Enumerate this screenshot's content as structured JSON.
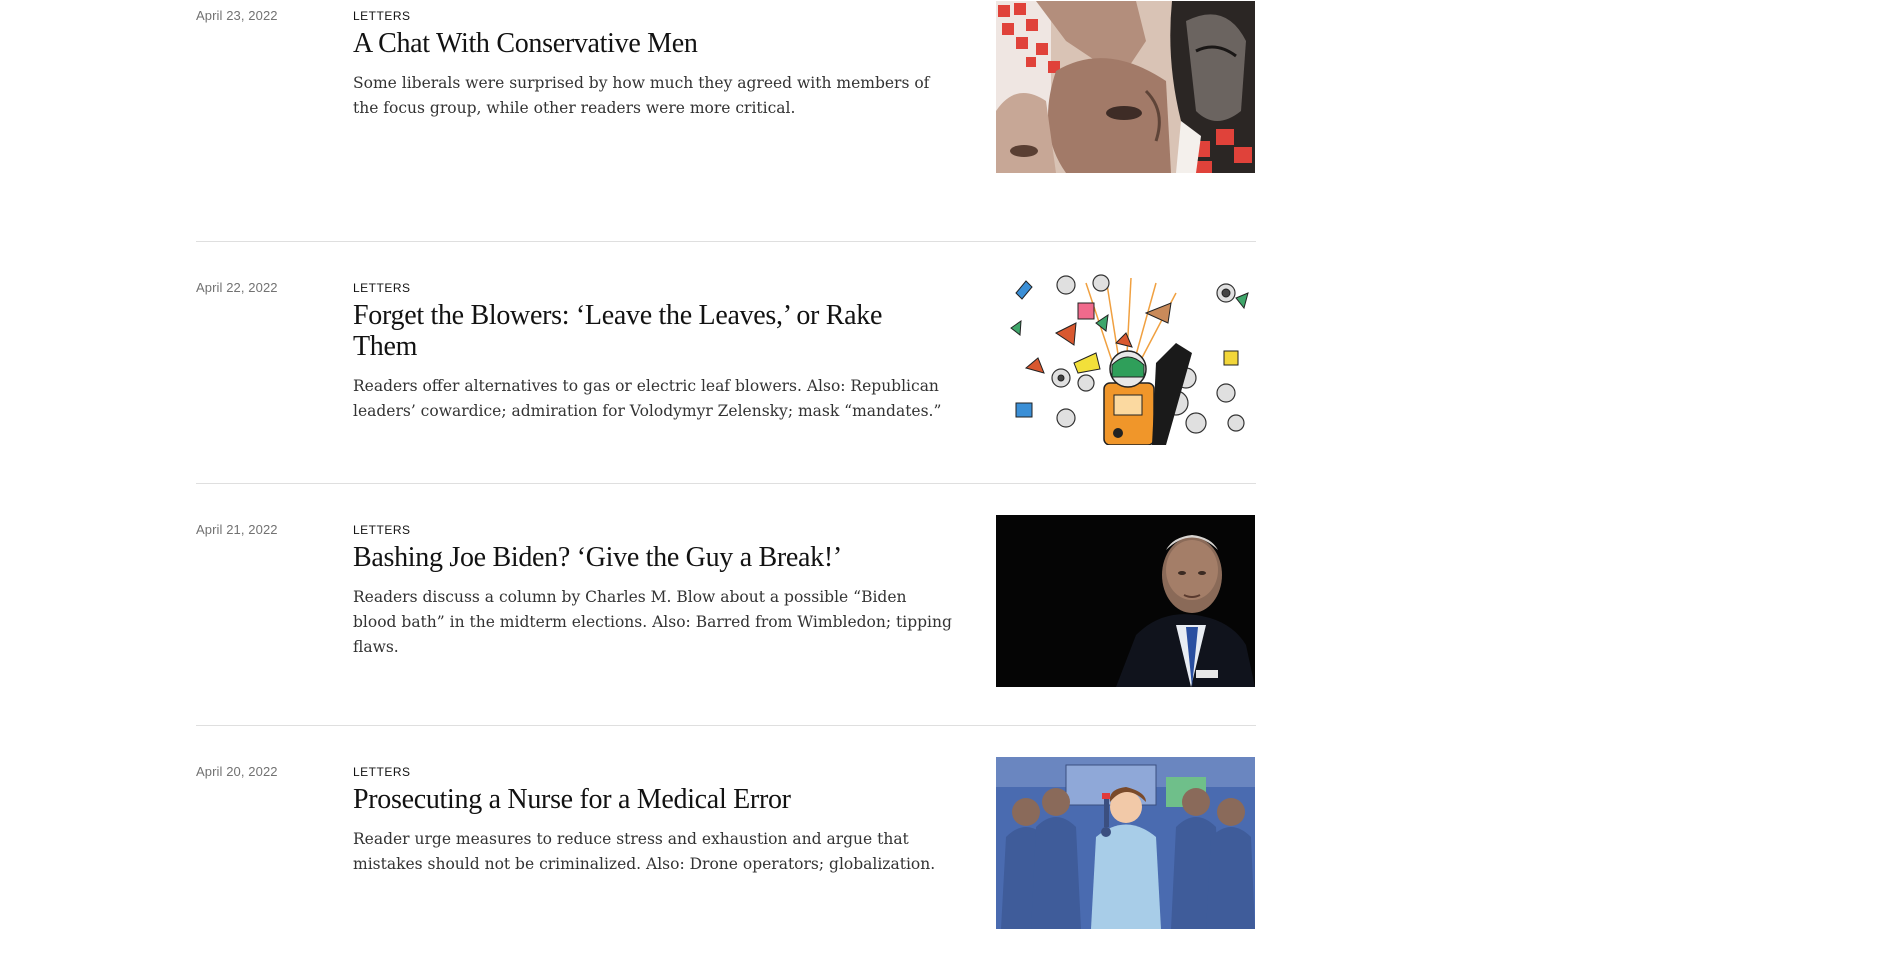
{
  "articles": [
    {
      "date": "April 23, 2022",
      "kicker": "LETTERS",
      "headline": "A Chat With Conservative Men",
      "summary": "Some liberals were surprised by how much they agreed with members of the focus group, while other readers were more critical.",
      "image": "collage-of-faces-illustration"
    },
    {
      "date": "April 22, 2022",
      "kicker": "LETTERS",
      "headline": "Forget the Blowers: ‘Leave the Leaves,’ or Rake Them",
      "summary": "Readers offer alternatives to gas or electric leaf blowers. Also: Republican leaders’ cowardice; admiration for Volodymyr Zelensky; mask “mandates.”",
      "image": "leaf-blower-illustration"
    },
    {
      "date": "April 21, 2022",
      "kicker": "LETTERS",
      "headline": "Bashing Joe Biden? ‘Give the Guy a Break!’",
      "summary": "Readers discuss a column by Charles M. Blow about a possible “Biden blood bath” in the midterm elections. Also: Barred from Wimbledon; tipping flaws.",
      "image": "joe-biden-photo"
    },
    {
      "date": "April 20, 2022",
      "kicker": "LETTERS",
      "headline": "Prosecuting a Nurse for a Medical Error",
      "summary": "Reader urge measures to reduce stress and exhaustion and argue that mistakes should not be criminalized. Also: Drone operators; globalization.",
      "image": "nurses-illustration"
    }
  ]
}
